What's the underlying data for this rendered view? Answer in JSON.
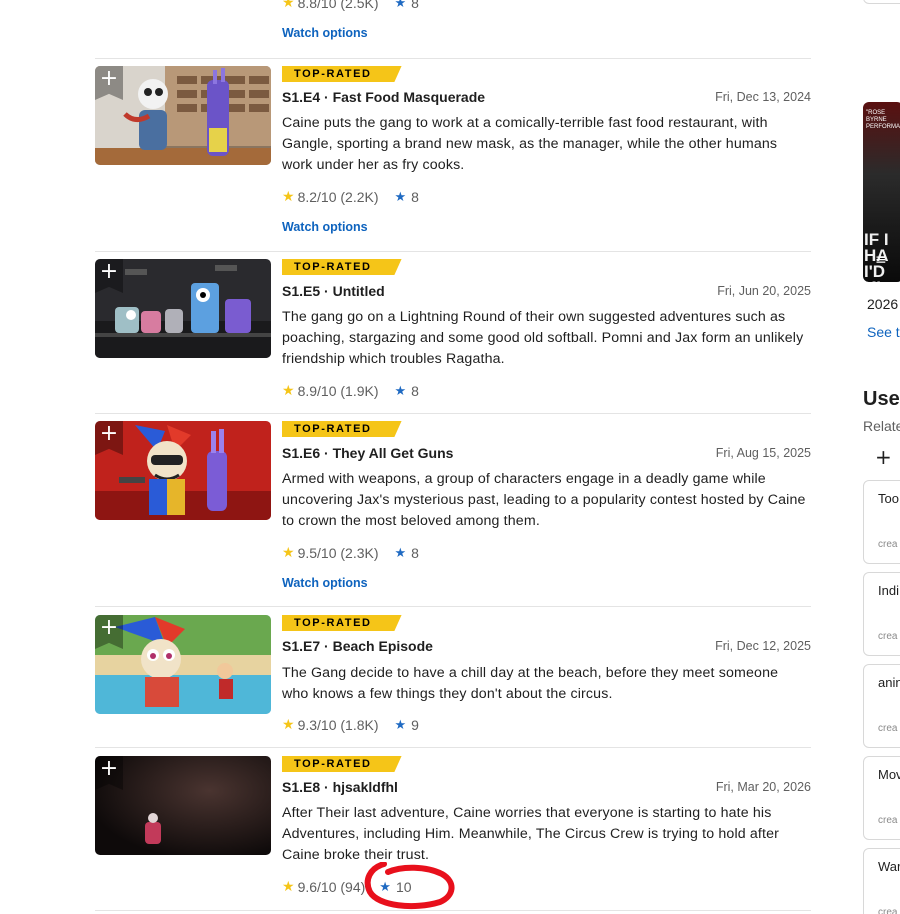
{
  "top_partial": {
    "rating": "8.8/10 (2.5K)",
    "user_rating": "8",
    "watch_label": "Watch options"
  },
  "episodes": [
    {
      "badge": "TOP-RATED",
      "title": "S1.E4 · Fast Food Masquerade",
      "date": "Fri, Dec 13, 2024",
      "description": "Caine puts the gang to work at a comically-terrible fast food restaurant, with Gangle, sporting a brand new mask, as the manager, while the other humans work under her as fry cooks.",
      "rating": "8.2/10 (2.2K)",
      "user_rating": "8",
      "watch_label": "Watch options"
    },
    {
      "badge": "TOP-RATED",
      "title": "S1.E5 · Untitled",
      "date": "Fri, Jun 20, 2025",
      "description": "The gang go on a Lightning Round of their own suggested adventures such as poaching, stargazing and some good old softball. Pomni and Jax form an unlikely friendship which troubles Ragatha.",
      "rating": "8.9/10 (1.9K)",
      "user_rating": "8"
    },
    {
      "badge": "TOP-RATED",
      "title": "S1.E6 · They All Get Guns",
      "date": "Fri, Aug 15, 2025",
      "description": "Armed with weapons, a group of characters engage in a deadly game while uncovering Jax's mysterious past, leading to a popularity contest hosted by Caine to crown the most beloved among them.",
      "rating": "9.5/10 (2.3K)",
      "user_rating": "8",
      "watch_label": "Watch options"
    },
    {
      "badge": "TOP-RATED",
      "title": "S1.E7 · Beach Episode",
      "date": "Fri, Dec 12, 2025",
      "description": "The Gang decide to have a chill day at the beach, before they meet someone who knows a few things they don't about the circus.",
      "rating": "9.3/10 (1.8K)",
      "user_rating": "9"
    },
    {
      "badge": "TOP-RATED",
      "title": "S1.E8 · hjsakldfhl",
      "date": "Fri, Mar 20, 2026",
      "description": "After Their last adventure, Caine worries that everyone is starting to hate his Adventures, including Him. Meanwhile, The Circus Crew is trying to hold after Caine broke their trust.",
      "rating": "9.6/10 (94",
      "rating_tail": ")",
      "user_rating": "10"
    }
  ],
  "sidebar": {
    "poster_text": "\"ROSE BYRNE PERFORMAN",
    "poster_title": "IF I HA I'D KI",
    "year": "2026",
    "see_link": "See t",
    "heading": "User",
    "subheading": "Relate",
    "lists": [
      "Too",
      "Indi",
      "anin",
      "Mov",
      "War"
    ],
    "list_meta": "crea"
  },
  "colors": {
    "accent_yellow": "#f5c518",
    "link_blue": "#0e63be",
    "user_star_blue": "#1f6ac2",
    "annotation_red": "#e8101c"
  }
}
